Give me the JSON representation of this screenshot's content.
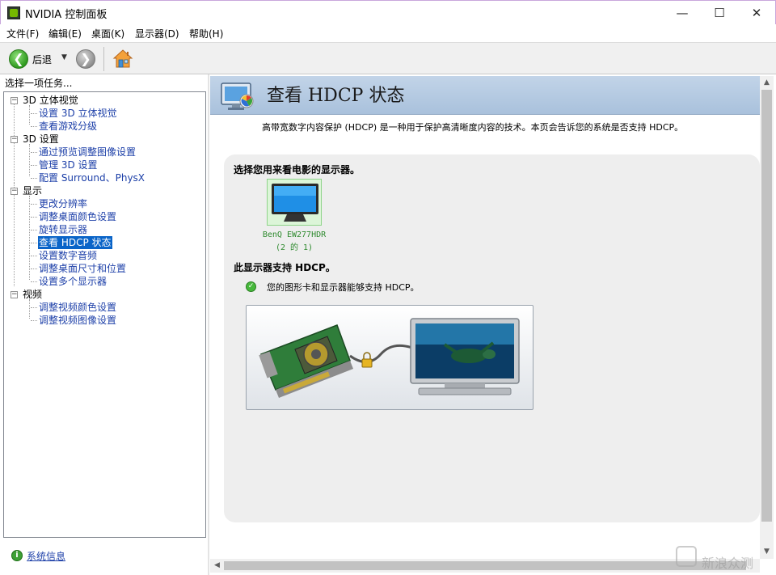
{
  "window": {
    "title": "NVIDIA 控制面板",
    "controls": {
      "minimize": "—",
      "maximize": "☐",
      "close": "✕"
    }
  },
  "menu": [
    "文件(F)",
    "编辑(E)",
    "桌面(K)",
    "显示器(D)",
    "帮助(H)"
  ],
  "toolbar": {
    "back_label": "后退",
    "back_glyph": "❮",
    "forward_glyph": "❯",
    "dropdown_glyph": "▼"
  },
  "sidebar": {
    "header": "选择一项任务...",
    "categories": [
      {
        "label": "3D 立体视觉",
        "toggle": "−",
        "items": [
          "设置 3D 立体视觉",
          "查看游戏分级"
        ]
      },
      {
        "label": "3D 设置",
        "toggle": "−",
        "items": [
          "通过预览调整图像设置",
          "管理 3D 设置",
          "配置 Surround、PhysX"
        ]
      },
      {
        "label": "显示",
        "toggle": "−",
        "items": [
          "更改分辨率",
          "调整桌面颜色设置",
          "旋转显示器",
          "查看 HDCP 状态",
          "设置数字音频",
          "调整桌面尺寸和位置",
          "设置多个显示器"
        ]
      },
      {
        "label": "视频",
        "toggle": "−",
        "items": [
          "调整视频颜色设置",
          "调整视频图像设置"
        ]
      }
    ],
    "selected_item": "查看 HDCP 状态",
    "system_info_label": "系统信息"
  },
  "content": {
    "title": "查看 HDCP 状态",
    "description": "高带宽数字内容保护 (HDCP) 是一种用于保护高清晰度内容的技术。本页会告诉您的系统是否支持 HDCP。",
    "select_display_label": "选择您用来看电影的显示器。",
    "monitor": {
      "name": "BenQ EW277HDR",
      "index": "(2 的 1)"
    },
    "support_heading": "此显示器支持 HDCP。",
    "support_status": "您的图形卡和显示器能够支持 HDCP。",
    "check_glyph": "✓"
  },
  "scrollbars": {
    "up": "▲",
    "down": "▼",
    "left": "◀"
  },
  "watermark": "新浪众测",
  "colors": {
    "accent": "#0a64c8",
    "link": "#1c3fa8",
    "header_band": "#b6cbe2",
    "nvidia_green": "#76b900"
  }
}
